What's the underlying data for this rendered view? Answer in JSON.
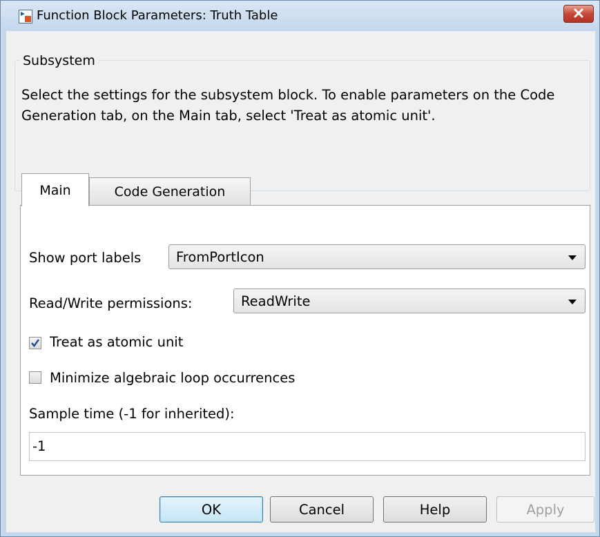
{
  "window": {
    "title": "Function Block Parameters: Truth Table",
    "close_icon": "close-icon",
    "app_icon": "simulink-block-icon"
  },
  "group": {
    "legend": "Subsystem",
    "description": "Select the settings for the subsystem block. To enable parameters on the Code Generation tab, on the Main tab, select 'Treat as atomic unit'."
  },
  "tabs": [
    {
      "label": "Main",
      "active": true
    },
    {
      "label": "Code Generation",
      "active": false
    }
  ],
  "main": {
    "show_port_labels": {
      "label": "Show port labels",
      "value": "FromPortIcon"
    },
    "read_write": {
      "label": "Read/Write permissions:",
      "value": "ReadWrite"
    },
    "treat_atomic": {
      "label": "Treat as atomic unit",
      "checked": true
    },
    "minimize_loop": {
      "label": "Minimize algebraic loop occurrences",
      "checked": false
    },
    "sample_time": {
      "label": "Sample time (-1 for inherited):",
      "value": "-1"
    }
  },
  "buttons": {
    "ok": "OK",
    "cancel": "Cancel",
    "help": "Help",
    "apply": "Apply"
  }
}
